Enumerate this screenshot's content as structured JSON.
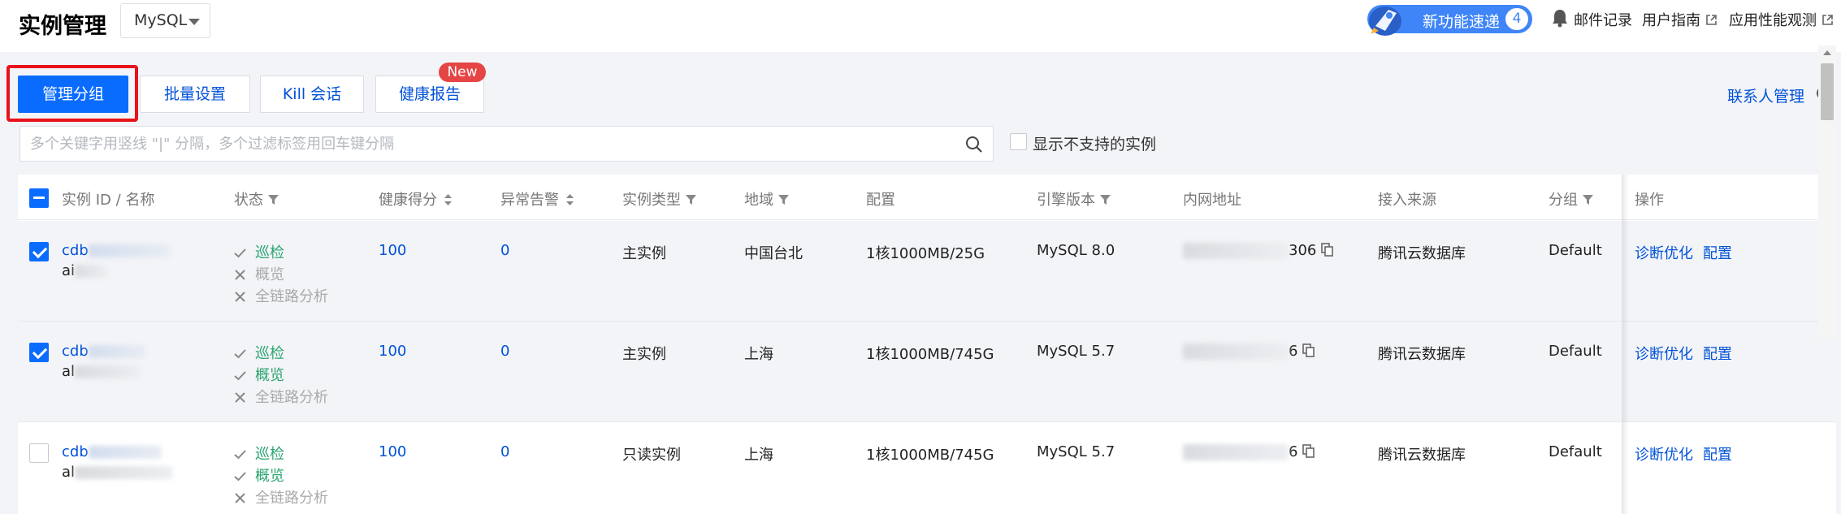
{
  "header": {
    "title": "实例管理",
    "db_type": "MySQL",
    "new_feature_label": "新功能速递",
    "new_feature_count": "4",
    "links": [
      "邮件记录",
      "用户指南",
      "应用性能观测"
    ]
  },
  "toolbar": {
    "buttons": [
      "管理分组",
      "批量设置",
      "Kill 会话",
      "健康报告"
    ],
    "new_badge": "New",
    "contact": "联系人管理"
  },
  "search": {
    "placeholder": "多个关键字用竖线 \"|\" 分隔，多个过滤标签用回车键分隔",
    "show_unsupported": "显示不支持的实例"
  },
  "table": {
    "columns": [
      "实例 ID / 名称",
      "状态",
      "健康得分",
      "异常告警",
      "实例类型",
      "地域",
      "配置",
      "引擎版本",
      "内网地址",
      "接入来源",
      "分组",
      "操作"
    ],
    "rows": [
      {
        "selected": true,
        "id_prefix": "cdb",
        "name_prefix": "ai",
        "status": [
          {
            "label": "巡检",
            "ok": true
          },
          {
            "label": "概览",
            "ok": false
          },
          {
            "label": "全链路分析",
            "ok": false
          }
        ],
        "health": "100",
        "alerts": "0",
        "type": "主实例",
        "region": "中国台北",
        "config": "1核1000MB/25G",
        "engine": "MySQL 8.0",
        "ip_tail": "306",
        "source": "腾讯云数据库",
        "group": "Default",
        "actions": [
          "诊断优化",
          "配置"
        ]
      },
      {
        "selected": true,
        "id_prefix": "cdb",
        "name_prefix": "al",
        "status": [
          {
            "label": "巡检",
            "ok": true
          },
          {
            "label": "概览",
            "ok": true
          },
          {
            "label": "全链路分析",
            "ok": false
          }
        ],
        "health": "100",
        "alerts": "0",
        "type": "主实例",
        "region": "上海",
        "config": "1核1000MB/745G",
        "engine": "MySQL 5.7",
        "ip_tail": "6",
        "source": "腾讯云数据库",
        "group": "Default",
        "actions": [
          "诊断优化",
          "配置"
        ]
      },
      {
        "selected": false,
        "id_prefix": "cdb",
        "name_prefix": "al",
        "status": [
          {
            "label": "巡检",
            "ok": true
          },
          {
            "label": "概览",
            "ok": true
          },
          {
            "label": "全链路分析",
            "ok": false
          }
        ],
        "health": "100",
        "alerts": "0",
        "type": "只读实例",
        "region": "上海",
        "config": "1核1000MB/745G",
        "engine": "MySQL 5.7",
        "ip_tail": "6",
        "source": "腾讯云数据库",
        "group": "Default",
        "actions": [
          "诊断优化",
          "配置"
        ]
      }
    ]
  },
  "colors": {
    "primary": "#0a6cff",
    "link": "#0052d9",
    "success": "#2ba471",
    "highlight": "#e8121a",
    "badge": "#e54545"
  }
}
